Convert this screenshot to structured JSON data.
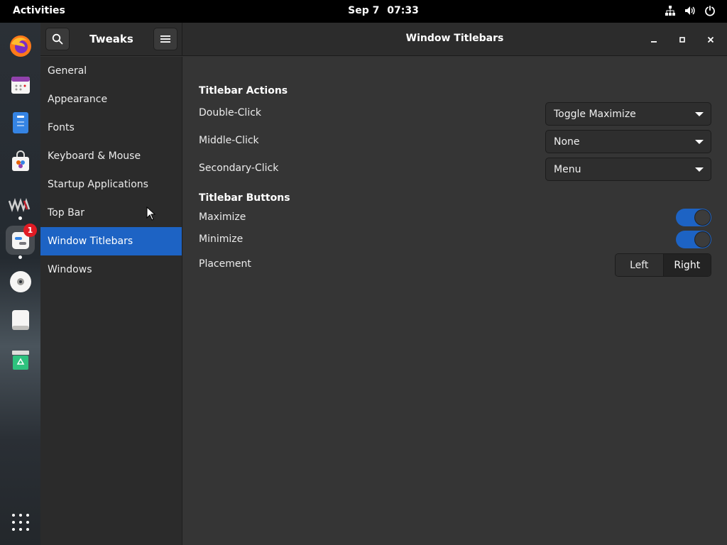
{
  "topbar": {
    "activities": "Activities",
    "date": "Sep 7",
    "time": "07:33"
  },
  "dock": {
    "notification_badge": "1"
  },
  "window": {
    "app_title": "Tweaks",
    "page_title": "Window Titlebars"
  },
  "sidebar": {
    "items": [
      {
        "label": "General"
      },
      {
        "label": "Appearance"
      },
      {
        "label": "Fonts"
      },
      {
        "label": "Keyboard & Mouse"
      },
      {
        "label": "Startup Applications"
      },
      {
        "label": "Top Bar"
      },
      {
        "label": "Window Titlebars"
      },
      {
        "label": "Windows"
      }
    ]
  },
  "titlebar_actions": {
    "heading": "Titlebar Actions",
    "double_click": {
      "label": "Double-Click",
      "value": "Toggle Maximize"
    },
    "middle_click": {
      "label": "Middle-Click",
      "value": "None"
    },
    "secondary_click": {
      "label": "Secondary-Click",
      "value": "Menu"
    }
  },
  "titlebar_buttons": {
    "heading": "Titlebar Buttons",
    "maximize": {
      "label": "Maximize",
      "enabled": true
    },
    "minimize": {
      "label": "Minimize",
      "enabled": true
    },
    "placement": {
      "label": "Placement",
      "options": [
        "Left",
        "Right"
      ],
      "selected": "Right"
    }
  },
  "colors": {
    "accent": "#1d63c4",
    "window_bg": "#353535",
    "sidebar_bg": "#2b2b2b",
    "topbar_bg": "#000000"
  }
}
